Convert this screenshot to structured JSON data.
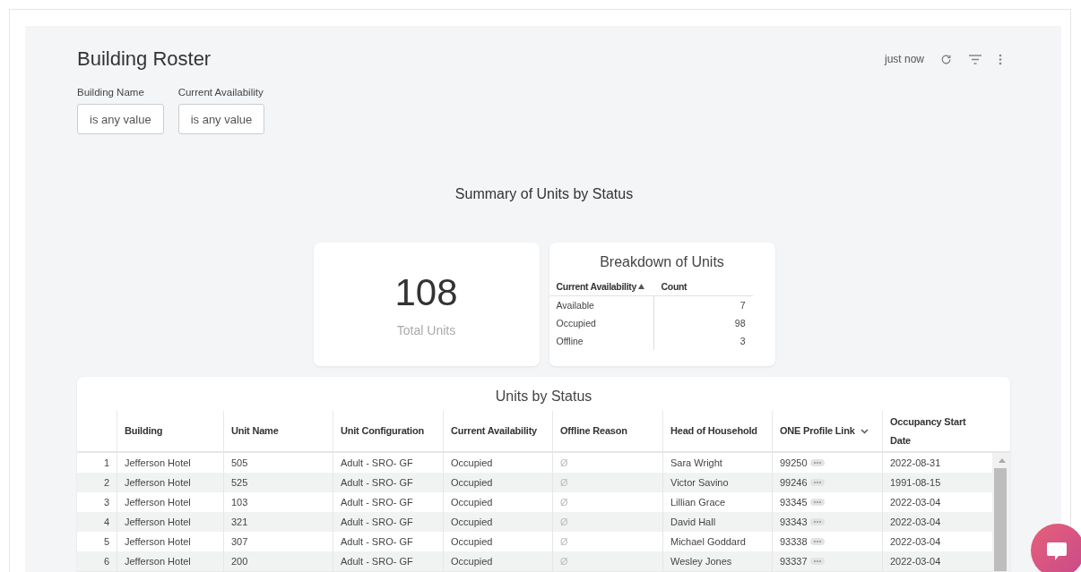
{
  "dashboard": {
    "title": "Building Roster",
    "updated": "just now"
  },
  "filters": [
    {
      "label": "Building Name",
      "value": "is any value"
    },
    {
      "label": "Current Availability",
      "value": "is any value"
    }
  ],
  "section_title": "Summary of Units by Status",
  "total_card": {
    "value": "108",
    "label": "Total Units"
  },
  "breakdown": {
    "title": "Breakdown of Units",
    "columns": [
      "Current Availability",
      "Count"
    ],
    "rows": [
      [
        "Available",
        "7"
      ],
      [
        "Occupied",
        "98"
      ],
      [
        "Offline",
        "3"
      ]
    ]
  },
  "units_table": {
    "title": "Units by Status",
    "columns": [
      "Building",
      "Unit Name",
      "Unit Configuration",
      "Current Availability",
      "Offline Reason",
      "Head of Household",
      "ONE Profile Link",
      "Occupancy Start Date"
    ],
    "rows": [
      {
        "index": "1",
        "cells": [
          "Jefferson Hotel",
          "505",
          "Adult - SRO- GF",
          "Occupied",
          "Ø",
          "Sara Wright",
          "99250",
          "2022-08-31"
        ]
      },
      {
        "index": "2",
        "cells": [
          "Jefferson Hotel",
          "525",
          "Adult - SRO- GF",
          "Occupied",
          "Ø",
          "Victor Savino",
          "99246",
          "1991-08-15"
        ]
      },
      {
        "index": "3",
        "cells": [
          "Jefferson Hotel",
          "103",
          "Adult - SRO- GF",
          "Occupied",
          "Ø",
          "Lillian Grace",
          "93345",
          "2022-03-04"
        ]
      },
      {
        "index": "4",
        "cells": [
          "Jefferson Hotel",
          "321",
          "Adult - SRO- GF",
          "Occupied",
          "Ø",
          "David Hall",
          "93343",
          "2022-03-04"
        ]
      },
      {
        "index": "5",
        "cells": [
          "Jefferson Hotel",
          "307",
          "Adult - SRO- GF",
          "Occupied",
          "Ø",
          "Michael Goddard",
          "93338",
          "2022-03-04"
        ]
      },
      {
        "index": "6",
        "cells": [
          "Jefferson Hotel",
          "200",
          "Adult - SRO- GF",
          "Occupied",
          "Ø",
          "Wesley Jones",
          "93337",
          "2022-03-04"
        ]
      }
    ]
  }
}
